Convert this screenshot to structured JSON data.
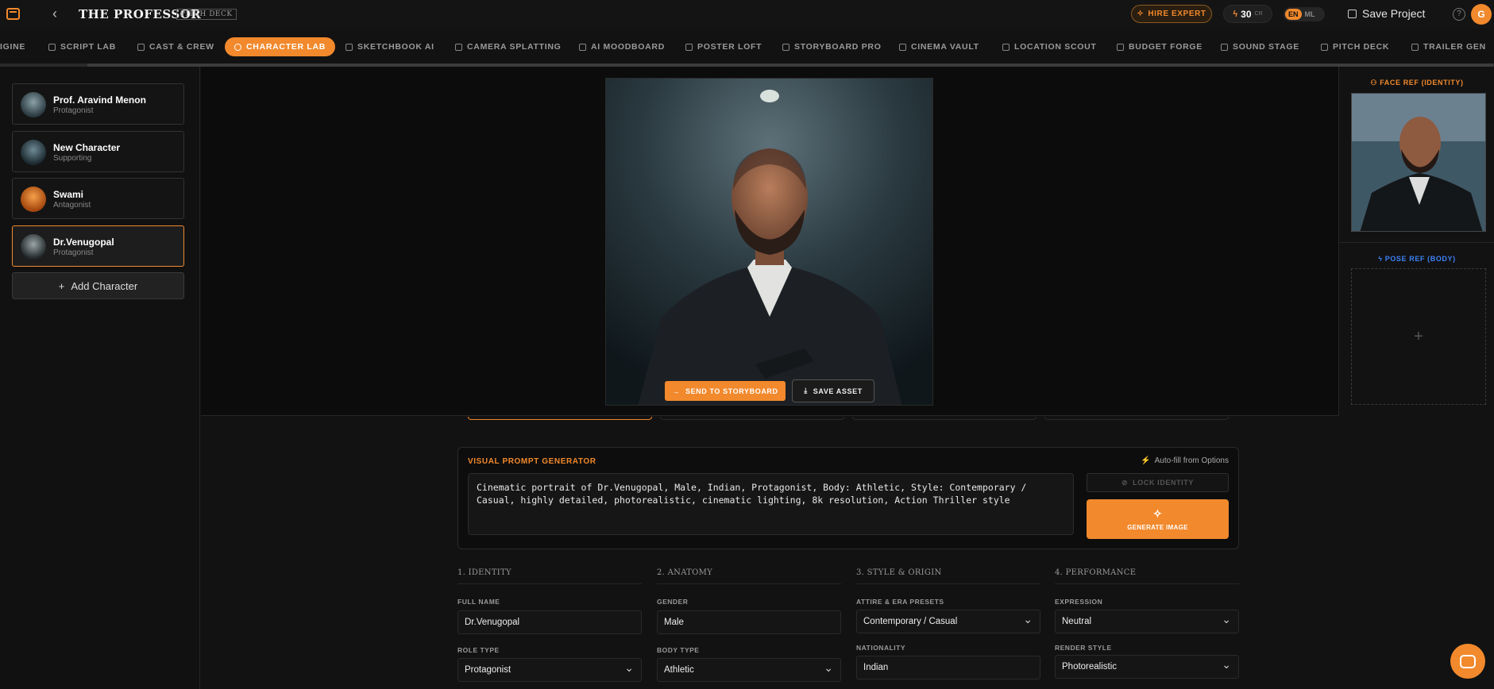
{
  "header": {
    "title": "THE PROFESSOR",
    "badge": "PITCH DECK",
    "hire_label": "HIRE EXPERT",
    "credits_value": "30",
    "credits_unit": "CR",
    "lang_active": "EN",
    "lang_inactive": "ML",
    "save_label": "Save Project",
    "help_glyph": "?",
    "user_initial": "G"
  },
  "tabs": [
    {
      "label": "IGINE"
    },
    {
      "label": "SCRIPT LAB"
    },
    {
      "label": "CAST & CREW"
    },
    {
      "label": "CHARACTER LAB"
    },
    {
      "label": "SKETCHBOOK AI"
    },
    {
      "label": "CAMERA SPLATTING"
    },
    {
      "label": "AI MOODBOARD"
    },
    {
      "label": "POSTER LOFT"
    },
    {
      "label": "STORYBOARD PRO"
    },
    {
      "label": "CINEMA VAULT"
    },
    {
      "label": "LOCATION SCOUT"
    },
    {
      "label": "BUDGET FORGE"
    },
    {
      "label": "SOUND STAGE"
    },
    {
      "label": "PITCH DECK"
    },
    {
      "label": "TRAILER GEN"
    }
  ],
  "characters": [
    {
      "name": "Prof. Aravind Menon",
      "role": "Protagonist"
    },
    {
      "name": "New Character",
      "role": "Supporting"
    },
    {
      "name": "Swami",
      "role": "Antagonist"
    },
    {
      "name": "Dr.Venugopal",
      "role": "Protagonist"
    }
  ],
  "add_character_label": "Add Character",
  "stage": {
    "send_label": "SEND TO STORYBOARD",
    "save_label": "SAVE ASSET"
  },
  "refs": {
    "face_title": "FACE REF (IDENTITY)",
    "pose_title": "POSE REF (BODY)",
    "add_glyph": "+"
  },
  "prompt_generator": {
    "title": "VISUAL PROMPT GENERATOR",
    "autofill_label": "Auto-fill from Options",
    "prompt_text": "Cinematic portrait of Dr.Venugopal, Male, Indian, Protagonist, Body: Athletic, Style: Contemporary / Casual, highly detailed, photorealistic, cinematic lighting, 8k resolution, Action Thriller style",
    "lock_label": "LOCK IDENTITY",
    "generate_label": "GENERATE IMAGE"
  },
  "form": {
    "identity": {
      "heading": "1. IDENTITY",
      "full_name_label": "FULL NAME",
      "full_name_value": "Dr.Venugopal",
      "role_type_label": "ROLE TYPE",
      "role_type_value": "Protagonist"
    },
    "anatomy": {
      "heading": "2. ANATOMY",
      "gender_label": "GENDER",
      "gender_value": "Male",
      "body_type_label": "BODY TYPE",
      "body_type_value": "Athletic"
    },
    "style": {
      "heading": "3. STYLE & ORIGIN",
      "attire_label": "ATTIRE & ERA PRESETS",
      "attire_value": "Contemporary / Casual",
      "nationality_label": "NATIONALITY",
      "nationality_value": "Indian"
    },
    "performance": {
      "heading": "4. PERFORMANCE",
      "expression_label": "EXPRESSION",
      "expression_value": "Neutral",
      "render_label": "RENDER STYLE",
      "render_value": "Photorealistic"
    }
  },
  "colors": {
    "accent": "#f2892c",
    "pose_accent": "#3b82f6",
    "background": "#121212"
  }
}
